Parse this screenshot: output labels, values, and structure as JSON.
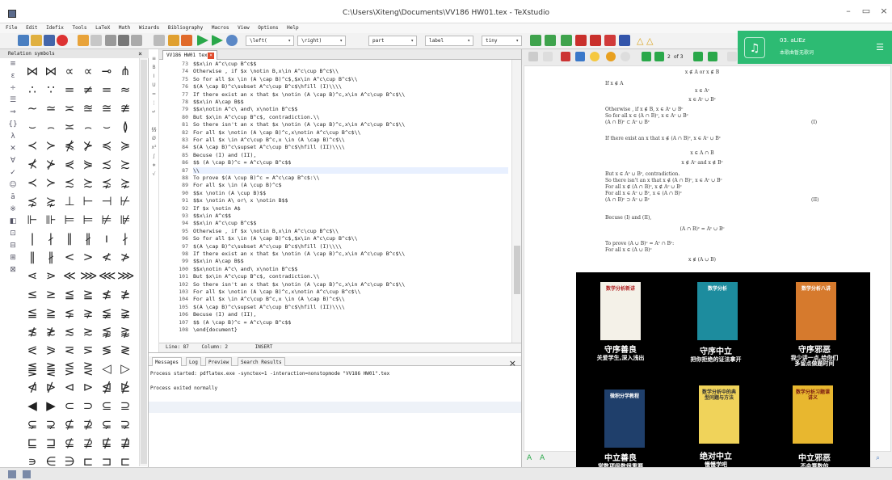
{
  "window": {
    "title": "C:\\Users\\Xiteng\\Documents\\VV186 HW01.tex - TeXstudio",
    "controls": [
      "–",
      "▭",
      "×"
    ]
  },
  "menu": [
    "File",
    "Edit",
    "Idefix",
    "Tools",
    "LaTeX",
    "Math",
    "Wizards",
    "Bibliography",
    "Macros",
    "View",
    "Options",
    "Help"
  ],
  "toolbar": {
    "combos": [
      "\\left(",
      "\\right)",
      "part",
      "label",
      "tiny"
    ],
    "math_glyphs": "△ △"
  },
  "left_panel": {
    "title": "Relation symbols",
    "close": "×",
    "side_icons": [
      "≡",
      "ε",
      "÷",
      "☰",
      "⇒",
      "{}",
      "λ",
      "✕",
      "∀",
      "✓",
      "☺",
      "ā",
      "※",
      "◧",
      "⊡",
      "⊟",
      "⊞",
      "⊠"
    ],
    "symbols": [
      [
        "⋈",
        "⋈",
        "∝",
        "∝",
        "⊸",
        "⋔"
      ],
      [
        "∴",
        "∵",
        "=",
        "≠",
        "=",
        "≈"
      ],
      [
        "∼",
        "≃",
        "≍",
        "≊",
        "≅",
        "≇"
      ],
      [
        "⌣",
        "⌢",
        "≍",
        "⌢",
        "⌣",
        "≬"
      ],
      [
        "≺",
        "≻",
        "⋠",
        "⊁",
        "≼",
        "≽"
      ],
      [
        "⊀",
        "⊁",
        "⋞",
        "⋟",
        "≾",
        "≿"
      ],
      [
        "≺",
        "≻",
        "≾",
        "≿",
        "⋨",
        "⋩"
      ],
      [
        "⋨",
        "⋩",
        "⊥",
        "⊢",
        "⊣",
        "⊬"
      ],
      [
        "⊩",
        "⊪",
        "⊨",
        "⊨",
        "⊭",
        "⊯"
      ],
      [
        "|",
        "∤",
        "∥",
        "∦",
        "ı",
        "∤"
      ],
      [
        "∥",
        "∦",
        "<",
        ">",
        "≮",
        "≯"
      ],
      [
        "⋖",
        "⋗",
        "≪",
        "⋙",
        "⋘",
        "⋙"
      ],
      [
        "≤",
        "≥",
        "≦",
        "≧",
        "≰",
        "≱"
      ],
      [
        "≦",
        "≧",
        "⪇",
        "⪈",
        "≨",
        "≩"
      ],
      [
        "≴",
        "≵",
        "≲",
        "≳",
        "⪉",
        "⪊"
      ],
      [
        "⪕",
        "⪖",
        "⋜",
        "⋝",
        "≶",
        "≷"
      ],
      [
        "⪋",
        "⪌",
        "⋚",
        "⋛",
        "◁",
        "▷"
      ],
      [
        "⋪",
        "⋫",
        "⊲",
        "⊳",
        "⋬",
        "⋭"
      ],
      [
        "◀",
        "▶",
        "⊂",
        "⊃",
        "⊆",
        "⊇"
      ],
      [
        "⊊",
        "⊋",
        "⊈",
        "⊉",
        "⊊",
        "⊋"
      ],
      [
        "⊑",
        "⊒",
        "⊈",
        "⊉",
        "⋢",
        "⋣"
      ],
      [
        "∍",
        "∈",
        "∋",
        "⊏",
        "⊐",
        "⊏"
      ]
    ]
  },
  "editor": {
    "tab_label": "VV186 HW01 tex",
    "lines": [
      {
        "n": "73",
        "t": "$$x\\in A^c\\cup B^c$$"
      },
      {
        "n": "74",
        "t": "Otherwise , if $x \\notin B,x\\in A^c\\cup B^c$\\\\"
      },
      {
        "n": "75",
        "t": "So for all $x \\in (A \\cap B)^c$,$x\\in A^c\\cup B^c$\\\\"
      },
      {
        "n": "76",
        "t": "$(A \\cap B)^c\\subset A^c\\cup B^c$\\hfill (I)\\\\\\\\"
      },
      {
        "n": "77",
        "t": "If there exist an x that $x \\notin (A \\cap B)^c,x\\in A^c\\cup B^c$\\\\"
      },
      {
        "n": "78",
        "t": "$$x\\in A\\cap B$$"
      },
      {
        "n": "79",
        "t": "$$x\\notin A^c\\ and\\ x\\notin B^c$$"
      },
      {
        "n": "80",
        "t": "But $x\\in A^c\\cup B^c$, contradiction.\\\\"
      },
      {
        "n": "81",
        "t": "So there isn't an x that $x \\notin (A \\cap B)^c,x\\in A^c\\cup B^c$\\\\"
      },
      {
        "n": "82",
        "t": "For all $x \\notin (A \\cap B)^c,x\\notin A^c\\cup B^c$\\\\"
      },
      {
        "n": "83",
        "t": "For all $x \\in A^c\\cup B^c,x \\in (A \\cap B)^c$\\\\"
      },
      {
        "n": "84",
        "t": "$(A \\cap B)^c\\supset A^c\\cup B^c$\\hfill (II)\\\\\\\\"
      },
      {
        "n": "85",
        "t": "Becuse (I) and (II),"
      },
      {
        "n": "86",
        "t": "$$ (A \\cap B)^c = A^c\\cup B^c$$"
      },
      {
        "n": "87",
        "t": "\\\\"
      },
      {
        "n": "88",
        "t": "To prove $(A \\cup B)^c = A^c\\cap B^c$:\\\\"
      },
      {
        "n": "89",
        "t": "For all $x \\in (A \\cup B)^c$"
      },
      {
        "n": "90",
        "t": "$$x \\notin (A \\cup B)$$"
      },
      {
        "n": "91",
        "t": "$$x \\notin A\\ or\\ x \\notin B$$"
      },
      {
        "n": "92",
        "t": "If $x \\notin A$"
      },
      {
        "n": "93",
        "t": "$$x\\in A^c$$"
      },
      {
        "n": "94",
        "t": "$$x\\in A^c\\cup B^c$$"
      },
      {
        "n": "95",
        "t": "Otherwise , if $x \\notin B,x\\in A^c\\cup B^c$\\\\"
      },
      {
        "n": "96",
        "t": "So for all $x \\in (A \\cap B)^c$,$x\\in A^c\\cup B^c$\\\\"
      },
      {
        "n": "97",
        "t": "$(A \\cap B)^c\\subset A^c\\cup B^c$\\hfill (I)\\\\\\\\"
      },
      {
        "n": "98",
        "t": "If there exist an x that $x \\notin (A \\cap B)^c,x\\in A^c\\cup B^c$\\\\"
      },
      {
        "n": "99",
        "t": "$$x\\in A\\cap B$$"
      },
      {
        "n": "100",
        "t": "$$x\\notin A^c\\ and\\ x\\notin B^c$$"
      },
      {
        "n": "101",
        "t": "But $x\\in A^c\\cup B^c$, contradiction.\\\\"
      },
      {
        "n": "102",
        "t": "So there isn't an x that $x \\notin (A \\cap B)^c,x\\in A^c\\cup B^c$\\\\"
      },
      {
        "n": "103",
        "t": "For all $x \\notin (A \\cap B)^c,x\\notin A^c\\cup B^c$\\\\"
      },
      {
        "n": "104",
        "t": "For all $x \\in A^c\\cup B^c,x \\in (A \\cap B)^c$\\\\"
      },
      {
        "n": "105",
        "t": "$(A \\cap B)^c\\supset A^c\\cup B^c$\\hfill (II)\\\\\\\\"
      },
      {
        "n": "106",
        "t": "Becuse (I) and (II),"
      },
      {
        "n": "107",
        "t": "$$ (A \\cap B)^c = A^c\\cup B^c$$"
      },
      {
        "n": "108",
        "t": "\\end{document}"
      }
    ],
    "status": {
      "line": "Line: 87",
      "column": "Column: 2",
      "mode": "INSERT"
    }
  },
  "messages": {
    "tabs": [
      "Messages",
      "Log",
      "Preview",
      "Search Results"
    ],
    "close": "×",
    "lines": [
      "Process started: pdflatex.exe -synctex=1 -interaction=nonstopmode \"VV186 HW01\".tex",
      "Process exited normally"
    ]
  },
  "pdf": {
    "page": "2",
    "of": "of 3",
    "lines": [
      {
        "t": "x ∉ A or x ∉ B",
        "c": true
      },
      {
        "t": "If x ∉ A",
        "c": false
      },
      {
        "t": "x ∈ Aᶜ",
        "c": true
      },
      {
        "t": "x ∈ Aᶜ ∪ Bᶜ",
        "c": true
      },
      {
        "t": "Otherwise , if x ∉ B, x ∈ Aᶜ ∪ Bᶜ",
        "c": false
      },
      {
        "t": "So for all x ∈ (A ∩ B)ᶜ, x ∈ Aᶜ ∪ Bᶜ",
        "c": false
      },
      {
        "t": "(A ∩ B)ᶜ ⊂ Aᶜ ∪ Bᶜ",
        "c": false,
        "r": "(I)"
      },
      {
        "t": "If there exist an x that x ∉ (A ∩ B)ᶜ, x ∈ Aᶜ ∪ Bᶜ",
        "c": false
      },
      {
        "t": "x ∈ A ∩ B",
        "c": true
      },
      {
        "t": "x ∉ Aᶜ and x ∉ Bᶜ",
        "c": true
      },
      {
        "t": "But x ∈ Aᶜ ∪ Bᶜ, contradiction.",
        "c": false
      },
      {
        "t": "So there isn't an x that x ∉ (A ∩ B)ᶜ, x ∈ Aᶜ ∪ Bᶜ",
        "c": false
      },
      {
        "t": "For all x ∉ (A ∩ B)ᶜ, x ∉ Aᶜ ∪ Bᶜ",
        "c": false
      },
      {
        "t": "For all x ∈ Aᶜ ∪ Bᶜ, x ∈ (A ∩ B)ᶜ",
        "c": false
      },
      {
        "t": "(A ∩ B)ᶜ ⊃ Aᶜ ∪ Bᶜ",
        "c": false,
        "r": "(II)"
      },
      {
        "t": "Becuse (I) and (II),",
        "c": false
      },
      {
        "t": "(A ∩ B)ᶜ = Aᶜ ∪ Bᶜ",
        "c": true
      },
      {
        "t": "To prove (A ∪ B)ᶜ = Aᶜ ∩ Bᶜ:",
        "c": false
      },
      {
        "t": "For all x ∈ (A ∪ B)ᶜ",
        "c": false
      },
      {
        "t": "x ∉ (A ∪ B)",
        "c": true
      }
    ]
  },
  "music": {
    "title": "03. aLIEz",
    "subtitle": "本歌曲暂无歌词"
  },
  "meme": {
    "books": [
      {
        "cover": "数学分析新讲",
        "color": "#f4f1e8",
        "fg": "#b02020"
      },
      {
        "cover": "数学分析",
        "color": "#1d8c9e",
        "fg": "#ffffff"
      },
      {
        "cover": "数学分析八讲",
        "color": "#d67a2d",
        "fg": "#ffffff"
      },
      {
        "cover": "微积分学教程",
        "color": "#1f3f6b",
        "fg": "#ffffff"
      },
      {
        "cover": "数学分析中的典型问题与方法",
        "color": "#f0d35a",
        "fg": "#333333"
      },
      {
        "cover": "数学分析习题课讲义",
        "color": "#e8b72f",
        "fg": "#7a1a10"
      }
    ],
    "captions": [
      {
        "a": "守序善良",
        "b": "关爱学生,深入浅出"
      },
      {
        "a": "守序中立",
        "b": "把你拒绝的证法拿开"
      },
      {
        "a": "守序邪恶",
        "b": "我少讲一点,给你们\n多留点做题时间"
      },
      {
        "a": "中立善良",
        "b": "常数项级数很重要\n至少要讲500页"
      },
      {
        "a": "绝对中立",
        "b": "慢慢学吧"
      },
      {
        "a": "中立邪恶",
        "b": "不会算数的\n都给我滚出数学系"
      }
    ]
  }
}
